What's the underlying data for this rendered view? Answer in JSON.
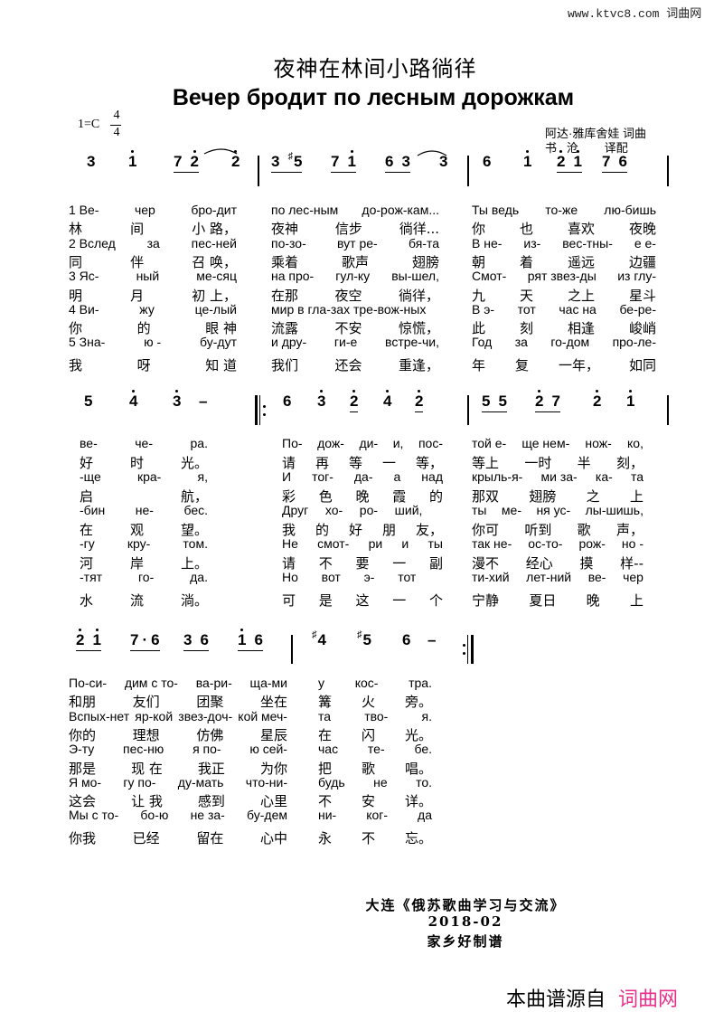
{
  "site_watermark": "www.ktvc8.com 词曲网",
  "title_cn": "夜神在林间小路徜徉",
  "title_ru": "Вечер бродит по лесным дорожкам",
  "key": "1=C",
  "time_signature": {
    "top": "4",
    "bottom": "4"
  },
  "credits": [
    "阿达·雅库舍娃 词曲",
    "书   沧        译配"
  ],
  "systems": [
    {
      "measures": [
        [
          {
            "n": "3"
          },
          {
            "n": "1'"
          },
          {
            "n": "72'",
            "beam": true
          },
          {
            "n": "2'"
          }
        ],
        [
          {
            "n": "3#5",
            "beam": true
          },
          {
            "n": "71'",
            "beam": true
          },
          {
            "n": "63",
            "beam": true
          },
          {
            "n": "3"
          }
        ],
        [
          {
            "n": "6"
          },
          {
            "n": "1'"
          },
          {
            "n": "2'1'",
            "beam": true
          },
          {
            "n": "76",
            "beam": true
          }
        ]
      ],
      "lyrics": [
        [
          [
            "1 Ве-",
            "чер",
            "бро-дит"
          ],
          [
            "по лес-ным",
            "до-рож-кам..."
          ],
          [
            "Ты ведь",
            "то-же",
            "лю-бишь"
          ]
        ],
        [
          [
            "林",
            "间",
            "小 路，"
          ],
          [
            "夜神",
            "信步",
            "徜徉..."
          ],
          [
            "你",
            "也",
            "喜欢",
            "夜晚"
          ]
        ],
        [
          [
            "2 Вслед",
            "за",
            "пес-ней"
          ],
          [
            "по-зо-",
            "вут ре-",
            "бя-та"
          ],
          [
            "В не-",
            "из-",
            "вес-тны-",
            "е е-"
          ]
        ],
        [
          [
            "同",
            "伴",
            "召 唤，"
          ],
          [
            "乘着",
            "歌声",
            "翅膀"
          ],
          [
            "朝",
            "着",
            "遥远",
            "边疆"
          ]
        ],
        [
          [
            "3 Яс-",
            "ный",
            "ме-сяц"
          ],
          [
            "на про-",
            "гул-ку",
            "вы-шел,"
          ],
          [
            "Смот-",
            "рят звез-ды",
            "из глу-"
          ]
        ],
        [
          [
            "明",
            "月",
            "初 上，"
          ],
          [
            "在那",
            "夜空",
            "徜徉，"
          ],
          [
            "九",
            "天",
            "之上",
            "星斗"
          ]
        ],
        [
          [
            "4 Ви-",
            "жу",
            "це-лый"
          ],
          [
            "мир в гла-зах тре-вож-ных"
          ],
          [
            "В э-",
            "тот",
            "час на",
            "бе-ре-"
          ]
        ],
        [
          [
            "你",
            "的",
            "眼 神"
          ],
          [
            "流露",
            "不安",
            "惊慌，"
          ],
          [
            "此",
            "刻",
            "相逢",
            "峻峭"
          ]
        ],
        [
          [
            "5 Зна-",
            "ю -",
            "бу-дут"
          ],
          [
            "и дру-",
            "ги-е",
            "встре-чи,"
          ],
          [
            "Год",
            "за",
            "го-дом",
            "про-ле-"
          ]
        ],
        [
          [
            "我",
            "呀",
            "知 道"
          ],
          [
            "我们",
            "还会",
            "重逢，"
          ],
          [
            "年",
            "复",
            "一年，",
            "如同"
          ]
        ]
      ]
    },
    {
      "measures": [
        [
          {
            "n": "5"
          },
          {
            "n": "4'"
          },
          {
            "n": "3'"
          },
          {
            "n": "–"
          }
        ],
        [
          {
            "n": "6"
          },
          {
            "n": "3'"
          },
          {
            "n": "2'",
            "beam": true
          },
          {
            "n": "4'"
          },
          {
            "n": "2'",
            "beam": true
          }
        ],
        [
          {
            "n": "55",
            "beam": true
          },
          {
            "n": "2'7",
            "beam": true
          },
          {
            "n": "2'"
          },
          {
            "n": "1'"
          }
        ]
      ],
      "lyrics": [
        [
          [
            "ве-",
            "че-",
            "ра."
          ],
          [
            "По-",
            "дож-",
            "ди-",
            "и,",
            "пос-"
          ],
          [
            "той е-",
            "ще нем-",
            "нож-",
            "ко,"
          ]
        ],
        [
          [
            "好",
            "时",
            "光。"
          ],
          [
            "请",
            "再",
            "等",
            "一",
            "等，"
          ],
          [
            "等上",
            "一时",
            "半",
            "刻，"
          ]
        ],
        [
          [
            "-ще",
            "кра-",
            "я,"
          ],
          [
            "И",
            "тог-",
            "да-",
            "а",
            "над"
          ],
          [
            "крыль-я-",
            "ми за-",
            "ка-",
            "та"
          ]
        ],
        [
          [
            "启",
            " ",
            "航，"
          ],
          [
            "彩",
            "色",
            "晚",
            "霞",
            "的"
          ],
          [
            "那双",
            "翅膀",
            "之",
            "上"
          ]
        ],
        [
          [
            "-бин",
            "не-",
            "бес."
          ],
          [
            "Друг",
            "хо-",
            "ро-",
            "ший,",
            " "
          ],
          [
            "ты",
            "ме-",
            "ня ус-",
            "лы-шишь,"
          ]
        ],
        [
          [
            "在",
            "观",
            "望。"
          ],
          [
            "我",
            "的",
            "好",
            "朋",
            "友，"
          ],
          [
            "你可",
            "听到",
            "歌",
            "声，"
          ]
        ],
        [
          [
            "-гу",
            "кру-",
            "том."
          ],
          [
            "Не",
            "смот-",
            "ри",
            "и",
            "ты"
          ],
          [
            "так не-",
            "ос-то-",
            "рож-",
            "но -"
          ]
        ],
        [
          [
            "河",
            "岸",
            "上。"
          ],
          [
            "请",
            "不",
            "要",
            "一",
            "副"
          ],
          [
            "漫不",
            "经心",
            "摸",
            "样--"
          ]
        ],
        [
          [
            "-тят",
            "го-",
            "да."
          ],
          [
            "Но",
            "вот",
            "э-",
            "тот",
            " "
          ],
          [
            "ти-хий",
            "лет-ний",
            "ве-",
            "чер"
          ]
        ],
        [
          [
            "水",
            "流",
            "淌。"
          ],
          [
            "可",
            "是",
            "这",
            "一",
            "个"
          ],
          [
            "宁静",
            "夏日",
            "晚",
            "上"
          ]
        ]
      ]
    },
    {
      "measures": [
        [
          {
            "n": "2'1'",
            "beam": true
          },
          {
            "n": "7·6",
            "beam": true
          },
          {
            "n": "36",
            "beam": true
          },
          {
            "n": "1'6",
            "beam": true
          }
        ],
        [
          {
            "n": "#4"
          },
          {
            "n": "#5"
          },
          {
            "n": "6"
          },
          {
            "n": "–"
          }
        ]
      ],
      "lyrics": [
        [
          [
            "По-си-",
            "дим с то-",
            "ва-ри-",
            "ща-ми"
          ],
          [
            "у",
            "кос-",
            "тра."
          ]
        ],
        [
          [
            "和朋",
            "友们",
            "团聚",
            "坐在"
          ],
          [
            "篝",
            "火",
            "旁。"
          ]
        ],
        [
          [
            "Вспых-нет",
            "яр-кой",
            "звез-доч-",
            "кой меч-"
          ],
          [
            "та",
            "тво-",
            "я."
          ]
        ],
        [
          [
            "你的",
            "理想",
            "仿佛",
            "星辰"
          ],
          [
            "在",
            "闪",
            "光。"
          ]
        ],
        [
          [
            "Э-ту",
            "пес-ню",
            "я по-",
            "ю сей-"
          ],
          [
            "час",
            "те-",
            "бе."
          ]
        ],
        [
          [
            "那是",
            "现 在",
            "我正",
            "为你"
          ],
          [
            "把",
            "歌",
            "唱。"
          ]
        ],
        [
          [
            "Я мо-",
            "гу по-",
            "ду-мать",
            "что-ни-"
          ],
          [
            "будь",
            "не",
            "то."
          ]
        ],
        [
          [
            "这会",
            "让 我",
            "感到",
            "心里"
          ],
          [
            "不",
            "安",
            "详。"
          ]
        ],
        [
          [
            "Мы с то-",
            "бо-ю",
            "не за-",
            "бу-дем"
          ],
          [
            "ни-",
            "ког-",
            "да"
          ]
        ],
        [
          [
            "你我",
            "已经",
            "留在",
            "心中"
          ],
          [
            "永",
            "不",
            "忘。"
          ]
        ]
      ]
    }
  ],
  "footer": [
    "大连《俄苏歌曲学习与交流》",
    "2018-02",
    "家乡好制谱"
  ],
  "watermark": {
    "text": "本曲谱源自",
    "brand": "词曲网",
    "brand_color": "#e8308a"
  }
}
